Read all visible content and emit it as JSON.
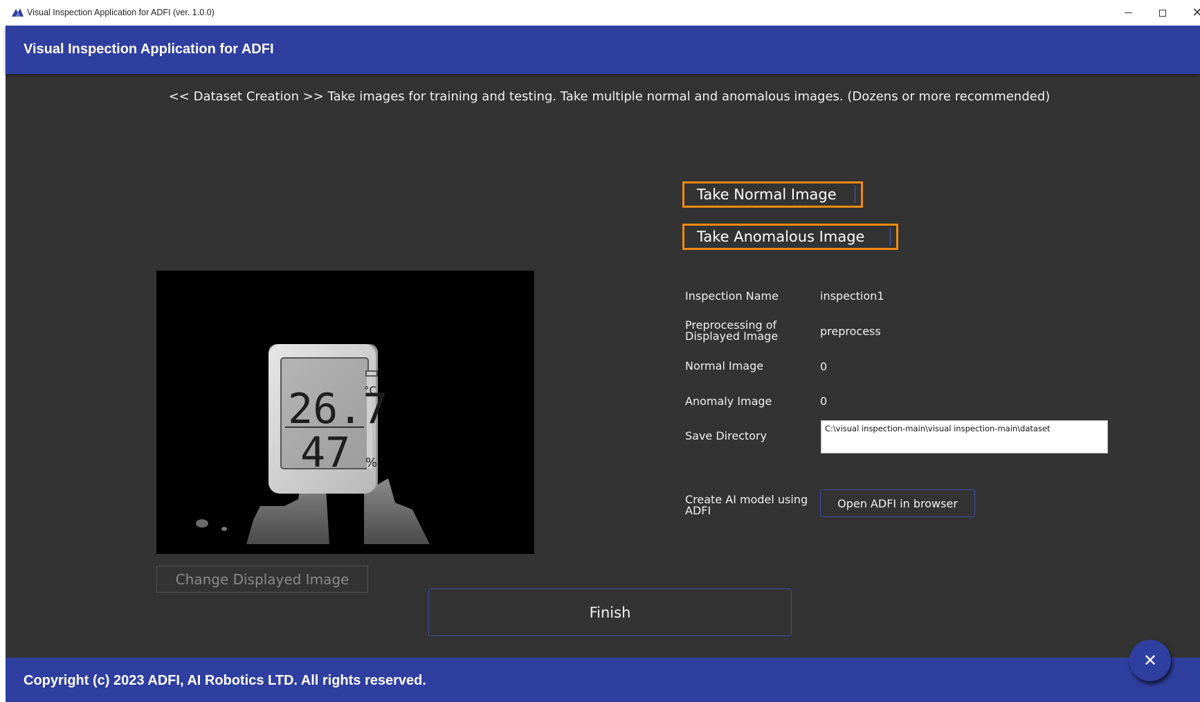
{
  "window": {
    "title": "Visual Inspection Application for ADFI (ver. 1.0.0)",
    "controls": {
      "minimize": "–",
      "maximize": "☐",
      "close": "✕"
    }
  },
  "header": {
    "title": "Visual Inspection Application for ADFI"
  },
  "instruction": "<< Dataset Creation >>  Take images for training and testing. Take multiple normal and anomalous images. (Dozens or more recommended)",
  "buttons": {
    "take_normal": "Take Normal Image",
    "take_anomalous": "Take Anomalous Image",
    "change_displayed": "Change Displayed Image",
    "finish": "Finish",
    "open_adfi": "Open ADFI in browser",
    "fab_close": "✕"
  },
  "info": {
    "inspection_name_label": "Inspection Name",
    "inspection_name_value": "inspection1",
    "preprocessing_label_line1": "Preprocessing of",
    "preprocessing_label_line2": "Displayed Image",
    "preprocessing_value": "preprocess",
    "normal_image_label": "Normal Image",
    "normal_image_value": "0",
    "anomaly_image_label": "Anomaly Image",
    "anomaly_image_value": "0",
    "save_directory_label": "Save Directory",
    "save_directory_value": "C:\\visual inspection-main\\visual inspection-main\\dataset",
    "create_ai_label_line1": "Create AI model using",
    "create_ai_label_line2": "ADFI"
  },
  "preview": {
    "temperature": "26.7",
    "temp_unit": "°C",
    "humidity": "47",
    "humidity_unit": "%"
  },
  "footer": {
    "copyright": "Copyright (c) 2023 ADFI, AI Robotics LTD. All rights reserved."
  },
  "colors": {
    "header": "#2e3f9f",
    "background": "#333333",
    "accent_border": "#f28a12",
    "button_border": "#3f4fae"
  },
  "icons": {
    "app": "adfi-logo-icon",
    "fab": "close-icon"
  }
}
